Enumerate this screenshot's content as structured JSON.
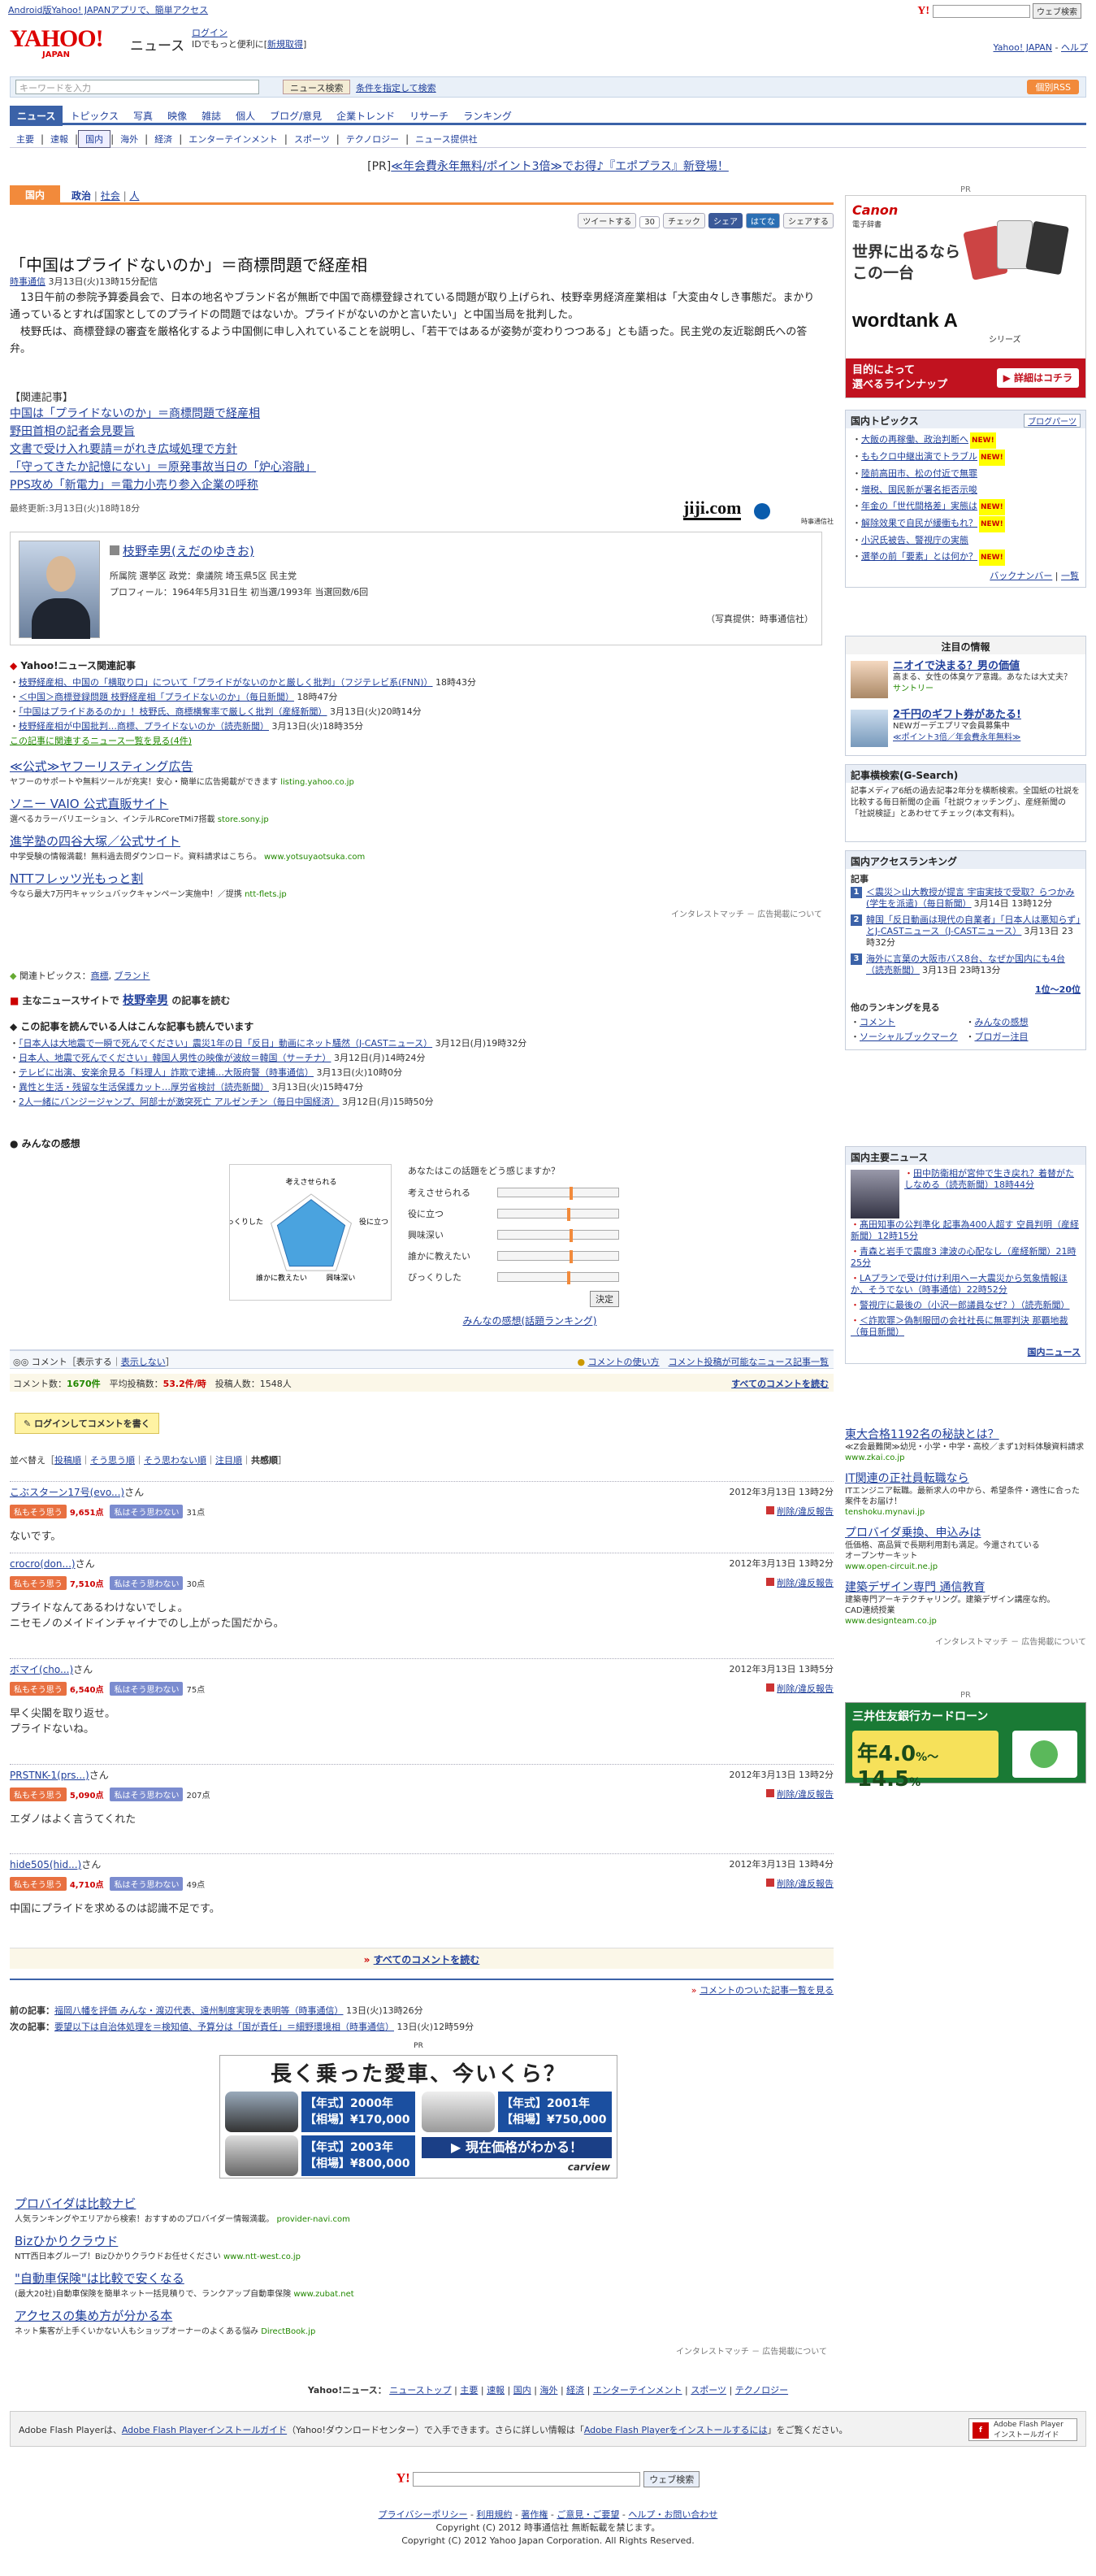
{
  "topbar": {
    "android": "Android版Yahoo! JAPANアプリで、簡単アクセス",
    "search_btn": "ウェブ検索"
  },
  "header": {
    "logo_main": "YAHOO!",
    "logo_sub": "JAPAN",
    "site": "ニュース",
    "login": "ログイン",
    "login_note": "IDでもっと便利に[",
    "signup": "新規取得",
    "login_close": "]",
    "yj_link": "Yahoo! JAPAN",
    "help": "ヘルプ"
  },
  "search": {
    "placeholder": "キーワードを入力",
    "button": "ニュース検索",
    "cond": "条件を指定して検索",
    "rss": "個別RSS"
  },
  "nav": [
    "ニュース",
    "トピックス",
    "写真",
    "映像",
    "雑誌",
    "個人",
    "ブログ/意見",
    "企業トレンド",
    "リサーチ",
    "ランキング"
  ],
  "subnav": [
    "主要",
    "速報",
    "国内",
    "海外",
    "経済",
    "エンターテインメント",
    "スポーツ",
    "テクノロジー",
    "ニュース提供社"
  ],
  "pr": {
    "label": "[PR]",
    "text": "≪年会費永年無料/ポイント3倍≫でお得♪『エポプラス』新登場！"
  },
  "category": {
    "tab": "国内",
    "subs": [
      "政治",
      "社会",
      "人"
    ],
    "sep": "|"
  },
  "share": [
    "ツイートする",
    "30",
    "チェック",
    "シェア",
    "はてな",
    "シェアする"
  ],
  "article": {
    "title": "「中国はプライドないのか」＝商標問題で経産相",
    "source": "時事通信",
    "date": "3月13日(火)13時15分配信",
    "body1": "　13日午前の参院予算委員会で、日本の地名やブランド名が無断で中国で商標登録されている問題が取り上げられ、枝野幸男経済産業相は「大変由々しき事態だ。まかり通っているとすれば国家としてのプライドの問題ではないか。プライドがないのかと言いたい」と中国当局を批判した。",
    "body2": "　枝野氏は、商標登録の審査を厳格化するよう中国側に申し入れていることを説明し、「若干ではあるが姿勢が変わりつつある」とも語った。民主党の友近聡朗氏への答弁。",
    "rel_head": "【関連記事】",
    "related": [
      "中国は「プライドないのか」＝商標問題で経産相",
      "野田首相の記者会見要旨",
      "文書で受け入れ要請＝がれき広域処理で方針",
      "「守ってきたか記憶にない」＝原発事故当日の「炉心溶融」",
      "PPS攻め「新電力」＝電力小売り参入企業の呼称"
    ],
    "updated": "最終更新:3月13日(火)18時18分",
    "jiji": "jiji.com",
    "jiji_sub": "時事通信社"
  },
  "person": {
    "name": "枝野幸男(えだのゆきお)",
    "meta1": "所属院 選挙区 政党：衆議院 埼玉県5区 民主党",
    "meta2": "プロフィール：1964年5月31日生 初当選/1993年 当選回数/6回",
    "credit": "（写真提供：時事通信社）"
  },
  "yjrel": {
    "head": "Yahoo!ニュース関連記事",
    "items": [
      {
        "t": "枝野経産相、中国の「横取り口」について「プライドがないのかと厳しく批判」",
        "s": "（フジテレビ系(FNN)）",
        "d": "18時43分"
      },
      {
        "t": "＜中国＞商標登録問題 枝野経産相「プライドないのか」",
        "s": "（毎日新聞）",
        "d": "18時47分"
      },
      {
        "t": "「中国はプライドあるのか」！枝野氏、商標横奪率で厳しく批判",
        "s": "（産経新聞）",
        "d": "3月13日(火)20時14分"
      },
      {
        "t": "枝野経産相が中国批判…商標、プライドないのか",
        "s": "（読売新聞）",
        "d": "3月13日(火)18時35分"
      }
    ],
    "more": "この記事に関連するニュース一覧を見る(4件)"
  },
  "ads": [
    {
      "t": "≪公式≫ヤフーリスティング広告",
      "d": "ヤフーのサポートや無料ツールが充実！安心・簡単に広告掲載ができます",
      "u": "listing.yahoo.co.jp"
    },
    {
      "t": "ソニー VAIO 公式直販サイト",
      "d": "選べるカラーバリエーション、インテルRCoreTMi7搭載",
      "u": "store.sony.jp"
    },
    {
      "t": "進学塾の四谷大塚／公式サイト",
      "d": "中学受験の情報満載！無料過去問ダウンロード。資料請求はこちら。",
      "u": "www.yotsuyaotsuka.com"
    },
    {
      "t": "NTTフレッツ光もっと割",
      "d": "今なら最大7万円キャッシュバックキャンペーン実施中！／提携",
      "u": "ntt-flets.jp"
    }
  ],
  "admatch": "インタレストマッチ － 広告掲載について",
  "topics": {
    "head": "関連トピックス",
    "items": [
      "商標",
      "ブランド"
    ]
  },
  "readon": {
    "pre": "主なニュースサイトで",
    "name": "枝野幸男",
    "post": "の記事を読む"
  },
  "alsoread": {
    "head": "この記事を読んでいる人はこんな記事も読んでいます",
    "items": [
      {
        "t": "「日本人は大地震で一瞬で死んでください」震災1年の日「反日」動画にネット騒然",
        "s": "（J-CASTニュース）",
        "d": "3月12日(月)19時32分"
      },
      {
        "t": "日本人、地震で死んでください」韓国人男性の映像が波紋＝韓国",
        "s": "（サーチナ）",
        "d": "3月12日(月)14時24分"
      },
      {
        "t": "テレビに出演、安楽余見る「料理人」詐欺で逮捕…大阪府警",
        "s": "（時事通信）",
        "d": "3月13日(火)10時0分"
      },
      {
        "t": "異性と生活・残留な生活保護カット…厚労省検討",
        "s": "（読売新聞）",
        "d": "3月13日(火)15時47分"
      },
      {
        "t": "2人一緒にバンジージャンプ、阿部士が激突死亡 アルゼンチン",
        "s": "（毎日中国経済）",
        "d": "3月12日(月)15時50分"
      }
    ]
  },
  "feelings": {
    "head": "みんなの感想",
    "q": "あなたはこの話題をどう感じますか？",
    "labels": [
      "考えさせられる",
      "役に立つ",
      "興味深い",
      "誰かに教えたい",
      "びっくりした"
    ],
    "values": [
      0.6,
      0.58,
      0.6,
      0.6,
      0.58
    ],
    "vote": "決定",
    "rank": "みんなの感想(話題ランキング)"
  },
  "comments": {
    "display": "コメント［表示する｜",
    "hide": "表示しない",
    "display_close": "］",
    "howto": "コメントの使い方",
    "list": "コメント投稿が可能なニュース記事一覧",
    "count_label": "コメント数：",
    "count": "1670件",
    "avg_label": "平均投稿数：",
    "avg": "53.2件/時",
    "posters_label": "投稿人数：",
    "posters": "1548人",
    "all": "すべてのコメントを読む",
    "login_btn": "ログインしてコメントを書く",
    "sort_label": "並べ替え［",
    "sort": [
      "投稿順",
      "そう思う順",
      "そう思わない順",
      "注目順",
      "共感順"
    ],
    "items": [
      {
        "user": "こぶスターン17号(evo...)",
        "suf": "さん",
        "date": "2012年3月13日 13時2分",
        "yes": "私もそう思う",
        "yc": "9,651点",
        "no": "私はそう思わない",
        "nc": "31点",
        "del": "削除/違反報告",
        "text": "ないです。"
      },
      {
        "user": "crocro(don...)",
        "suf": "さん",
        "date": "2012年3月13日 13時2分",
        "yes": "私もそう思う",
        "yc": "7,510点",
        "no": "私はそう思わない",
        "nc": "30点",
        "del": "削除/違反報告",
        "text": "プライドなんてあるわけないでしょ。",
        "text2": "ニセモノのメイドインチャイナでのし上がった国だから。"
      },
      {
        "user": "ボマイ(cho...)",
        "suf": "さん",
        "date": "2012年3月13日 13時5分",
        "yes": "私もそう思う",
        "yc": "6,540点",
        "no": "私はそう思わない",
        "nc": "75点",
        "del": "削除/違反報告",
        "text": "早く尖閣を取り返せ。",
        "text2": "プライドないね。"
      },
      {
        "user": "PRSTNK-1(prs...)",
        "suf": "さん",
        "date": "2012年3月13日 13時2分",
        "yes": "私もそう思う",
        "yc": "5,090点",
        "no": "私はそう思わない",
        "nc": "207点",
        "del": "削除/違反報告",
        "text": "エダノはよく言うてくれた"
      },
      {
        "user": "hide505(hid...)",
        "suf": "さん",
        "date": "2012年3月13日 13時4分",
        "yes": "私もそう思う",
        "yc": "4,710点",
        "no": "私はそう思わない",
        "nc": "49点",
        "del": "削除/違反報告",
        "text": "中国にプライドを求めるのは認識不足です。"
      }
    ],
    "all_bottom": "すべてのコメントを読む",
    "list_link": "コメントのついた記事一覧を見る"
  },
  "prevnext": {
    "prev_label": "前の記事：",
    "prev": "福岡八幡を評価 みんな・渡辺代表、遠州制度実現を表明等",
    "prev_s": "（時事通信）",
    "prev_d": "13日(火)13時26分",
    "next_label": "次の記事：",
    "next": "要望以下は自治体処理を＝検知値、予算分は「国が責任」＝細野環境相",
    "next_s": "（時事通信）",
    "next_d": "13日(火)12時59分"
  },
  "carad": {
    "pr": "PR",
    "title": "長く乗った愛車、今いくら？",
    "y1": "【年式】2000年",
    "p1": "【相場】¥170,000",
    "y2": "【年式】2001年",
    "p2": "【相場】¥750,000",
    "y3": "【年式】2003年",
    "p3": "【相場】¥800,000",
    "cta": "現在価格がわかる！",
    "brand": "carview"
  },
  "ads2": [
    {
      "t": "プロバイダは比較ナビ",
      "d": "人気ランキングやエリアから検索！おすすめのプロバイダー情報満載。",
      "u": "provider-navi.com"
    },
    {
      "t": "Bizひかりクラウド",
      "d": "NTT西日本グループ！Bizひかりクラウドお任せください",
      "u": "www.ntt-west.co.jp"
    },
    {
      "t": "\"自動車保険\"は比較で安くなる",
      "d": "(最大20社)自動車保険を簡単ネット一括見積りで、ランクアップ自動車保険",
      "u": "www.zubat.net"
    },
    {
      "t": "アクセスの集め方が分かる本",
      "d": "ネット集客が上手くいかない人もショップオーナーのよくある悩み",
      "u": "DirectBook.jp"
    }
  ],
  "side": {
    "pr": "PR",
    "canon": {
      "brand": "Canon",
      "sub": "電子辞書",
      "l1": "世界に出るなら",
      "l2": "この一台",
      "product": "wordtank A",
      "series": "シリーズ",
      "lineup1": "目的によって",
      "lineup2": "選べるラインナップ",
      "detail": "詳細はコチラ"
    },
    "topics": {
      "head": "国内トピックス",
      "blog": "ブログパーツ",
      "items": [
        {
          "t": "大飯の再稼働、政治判断へ",
          "n": true
        },
        {
          "t": "ももクロ中継出演でトラブル",
          "n": true
        },
        {
          "t": "陸前高田市、松の付近で無罪",
          "n": false
        },
        {
          "t": "増税、国民新が署名拒否示唆",
          "n": false
        },
        {
          "t": "年金の「世代間格差」実態は",
          "n": true
        },
        {
          "t": "解除效果で自民が緩衝もれ？",
          "n": true
        },
        {
          "t": "小沢氏被告、警視庁の実態",
          "n": false
        },
        {
          "t": "選挙の前「要素」とは何か？",
          "n": true
        }
      ],
      "backnum": "バックナンバー",
      "list": "一覧"
    },
    "notice": {
      "head": "注目の情報",
      "i1t": "ニオイで決まる？男の価値",
      "i1d": "高まる、女性の体臭ケア意識。あなたは大丈夫？",
      "i1s": "サントリー",
      "i2t": "2千円のギフト券があたる!",
      "i2d": "NEWガーデエプリマ会員募集中",
      "i2s": "≪ポイント3倍／年会費永年無料≫"
    },
    "gsearch": {
      "head": "記事横検索(G-Search)",
      "text": "記事メディア6紙の過去記事2年分を横断検索。全国紙の社説を比較する毎日新聞の企画「社説ウォッチング」、産経新聞の「社説検証」とあわせてチェック(本文有料)。"
    },
    "access": {
      "head": "国内アクセスランキング",
      "kind": "記事",
      "items": [
        {
          "t": "＜震災＞山大教授が提言 宇宙実技で受取？らつかみ(学生を派遣)",
          "s": "（毎日新聞）",
          "d": "3月14日 13時12分"
        },
        {
          "t": "韓国「反日動画は現代の自業者」「日本人は悪知らず」とJ-CASTニュース",
          "s": "（J-CASTニュース）",
          "d": "3月13日 23時32分"
        },
        {
          "t": "海外に言葉の大阪市バス8台、なぜか国内にも4台",
          "s": "（読売新聞）",
          "d": "3月13日 23時13分"
        }
      ],
      "page": "1位～20位",
      "other": "他のランキングを見る",
      "links": [
        "コメント",
        "みんなの感想",
        "ソーシャルブックマーク",
        "ブロガー注目"
      ]
    },
    "major": {
      "head": "国内主要ニュース",
      "items": [
        "田中防衛相が宮仲で生き戻れ？着替がたしなめる（読売新聞）18時44分",
        "髙田知事の公判準化 起事為400人超す 空員判明（産経新聞）12時15分",
        "青森と岩手で震度3 津波の心配なし（産経新聞）21時25分",
        "LAプランで受け付け利用ヘー大震災から気象情報ほか、そうでない（時事通信）22時52分",
        "警視庁に最後の（小沢一郎議員なぜ？）（読売新聞）",
        "＜詐欺罪＞偽制服団の会社社長に無罪判決 那覇地裁（毎日新聞）"
      ],
      "more": "国内ニュース"
    },
    "textads": [
      {
        "t": "東大合格1192名の秘訣とは？",
        "d": "≪Z会最難関≫幼児・小学・中学・高校／まず1対料体験資料請求",
        "u": "www.zkai.co.jp"
      },
      {
        "t": "IT関連の正社員転職なら",
        "d": "ITエンジニア転職。最新求人の中から、希望条件・適性に合った案件をお届け！",
        "u": "tenshoku.mynavi.jp"
      },
      {
        "t": "プロバイダ乗換、申込みは",
        "d": "低価格、高品質で長期利用割も満足。今還されている",
        "d2": "オープンサーキット",
        "u": "www.open-circuit.ne.jp"
      },
      {
        "t": "建築デザイン専門 通信教育",
        "d": "建築専門アーキテクチャリング。建築デザイン講座な約。",
        "d2": "CAD連続授業",
        "u": "www.designteam.co.jp"
      }
    ],
    "admatch": "インタレストマッチ － 広告掲載について",
    "bank": {
      "pr": "PR",
      "title": "三井住友銀行カードローン",
      "rate_lo": "年4.0",
      "rate_hi": "14.5",
      "pct": "%"
    }
  },
  "footer": {
    "label": "Yahoo!ニュース：",
    "nav": [
      "ニューストップ",
      "主要",
      "速報",
      "国内",
      "海外",
      "経済",
      "エンターテインメント",
      "スポーツ",
      "テクノロジー"
    ],
    "flash1": "Adobe Flash Playerは、",
    "flash_link": "Adobe Flash Playerインストールガイド",
    "flash2": "（Yahoo!ダウンロードセンター）で入手できます。さらに詳しい情報は「",
    "flash_link2": "Adobe Flash Playerをインストールするには",
    "flash3": "」をご覧ください。",
    "flash_btn1": "Adobe Flash Player",
    "flash_btn2": "インストールガイド",
    "search_btn": "ウェブ検索",
    "links": [
      "プライバシーポリシー",
      "利用規約",
      "著作権",
      "ご意見・ご要望",
      "ヘルプ・お問い合わせ"
    ],
    "copy1": "Copyright (C) 2012 時事通信社 無断転載を禁じます。",
    "copy2": "Copyright (C) 2012 Yahoo Japan Corporation. All Rights Reserved."
  }
}
